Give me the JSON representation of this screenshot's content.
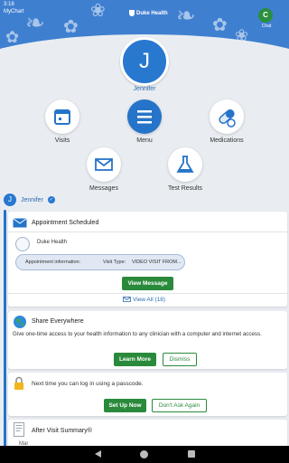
{
  "status": {
    "time": "3:18",
    "carrier": "MyChart"
  },
  "header": {
    "logo_text": "Duke Health",
    "corner_avatar_letter": "C",
    "corner_label": "Chat"
  },
  "profile": {
    "initial": "J",
    "name": "Jennifer"
  },
  "menu": [
    {
      "label": "Visits",
      "icon": "calendar-icon"
    },
    {
      "label": "Menu",
      "icon": "hamburger-icon"
    },
    {
      "label": "Medications",
      "icon": "pill-icon"
    },
    {
      "label": "Messages",
      "icon": "envelope-icon"
    },
    {
      "label": "Test Results",
      "icon": "flask-icon"
    }
  ],
  "feed_user": {
    "initial": "J",
    "name": "Jennifer",
    "badge": "✓"
  },
  "appointment_card": {
    "title": "Appointment Scheduled",
    "org": "Duke Health",
    "info_label": "Appointment information:",
    "visit_type_label": "Visit Type:",
    "visit_type_value": "VIDEO VISIT FROM...",
    "view_message": "View Message",
    "view_all": "View All (18)"
  },
  "share_card": {
    "title": "Share Everywhere",
    "body": "Give one-time access to your health information to any clinician with a computer and internet access.",
    "learn_more": "Learn More",
    "dismiss": "Dismiss"
  },
  "passcode_card": {
    "body": "Next time you can log in using a passcode.",
    "setup": "Set Up Now",
    "dont_ask": "Don't Ask Again"
  },
  "avs_card": {
    "title": "After Visit Summary®",
    "sub": "Mar"
  },
  "colors": {
    "accent": "#2674c9",
    "green": "#2a8a3b",
    "banner": "#3f7fd0"
  }
}
